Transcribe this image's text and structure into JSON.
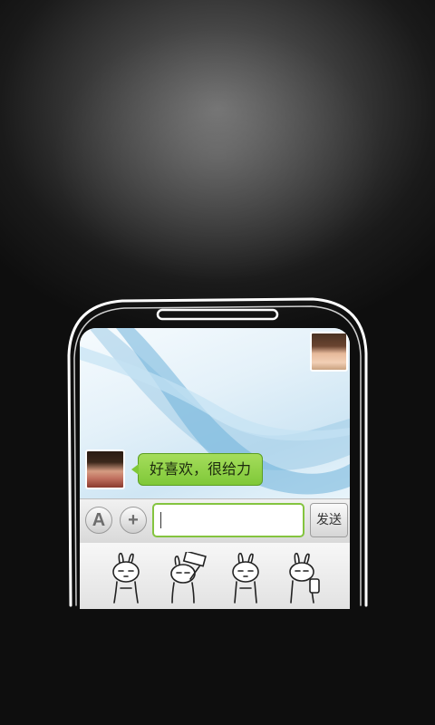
{
  "chat": {
    "message_text": "好喜欢，很给力",
    "send_label": "发送",
    "input_value": ""
  },
  "input_bar": {
    "font_button_glyph": "A",
    "add_button_glyph": "+"
  },
  "emoji_panel": {
    "stickers": [
      "rabbit-sticker",
      "rabbit-money-sticker",
      "rabbit-sticker",
      "rabbit-phone-sticker"
    ]
  },
  "colors": {
    "bubble": "#7fc838",
    "input_border": "#84c43f",
    "background": "#1a1a1a",
    "sketch_stroke": "#ffffff"
  }
}
